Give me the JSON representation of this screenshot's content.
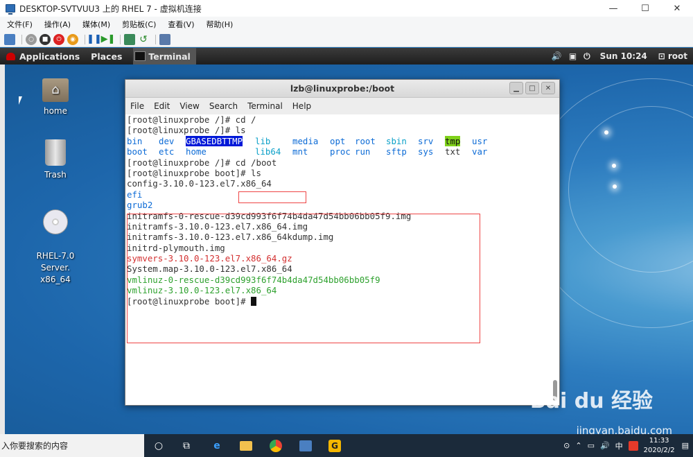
{
  "host": {
    "title": "DESKTOP-SVTVUU3 上的 RHEL 7 - 虚拟机连接",
    "menu": [
      "文件(F)",
      "操作(A)",
      "媒体(M)",
      "剪贴板(C)",
      "查看(V)",
      "帮助(H)"
    ]
  },
  "gnome": {
    "applications": "Applications",
    "places": "Places",
    "terminal_task": "Terminal",
    "clock": "Sun 10:24",
    "user": "root"
  },
  "desktop": {
    "icons": [
      {
        "label": "home"
      },
      {
        "label": "Trash"
      },
      {
        "label": "RHEL-7.0 Server.\nx86_64"
      }
    ]
  },
  "terminal": {
    "title": "lzb@linuxprobe:/boot",
    "menu": [
      "File",
      "Edit",
      "View",
      "Search",
      "Terminal",
      "Help"
    ],
    "lines": [
      "[root@linuxprobe /]# cd /",
      "[root@linuxprobe /]# ls"
    ],
    "ls_row1": [
      "bin",
      "dev",
      "GBASEDBTTMP",
      "lib",
      "media",
      "opt",
      "root",
      "sbin",
      "srv",
      "tmp",
      "usr"
    ],
    "ls_row2": [
      "boot",
      "etc",
      "home",
      "lib64",
      "mnt",
      "proc",
      "run",
      "sftp",
      "sys",
      "txt",
      "var"
    ],
    "cd_prompt": "[root@linuxprobe /]# ",
    "cd_cmd": "cd /boot",
    "ls_boot_cmd": "[root@linuxprobe boot]# ls",
    "boot_files": [
      {
        "name": "config-3.10.0-123.el7.x86_64",
        "color": "default"
      },
      {
        "name": "efi",
        "color": "blue"
      },
      {
        "name": "grub2",
        "color": "blue"
      },
      {
        "name": "initramfs-0-rescue-d39cd993f6f74b4da47d54bb06bb05f9.img",
        "color": "default"
      },
      {
        "name": "initramfs-3.10.0-123.el7.x86_64.img",
        "color": "default"
      },
      {
        "name": "initramfs-3.10.0-123.el7.x86_64kdump.img",
        "color": "default"
      },
      {
        "name": "initrd-plymouth.img",
        "color": "default"
      },
      {
        "name": "symvers-3.10.0-123.el7.x86_64.gz",
        "color": "red"
      },
      {
        "name": "System.map-3.10.0-123.el7.x86_64",
        "color": "default"
      },
      {
        "name": "vmlinuz-0-rescue-d39cd993f6f74b4da47d54bb06bb05f9",
        "color": "green"
      },
      {
        "name": "vmlinuz-3.10.0-123.el7.x86_64",
        "color": "green"
      }
    ],
    "final_prompt": "[root@linuxprobe boot]# "
  },
  "taskbar": {
    "search_placeholder": "在这里输入你要搜索的内容",
    "search_visible": "入你要搜索的内容",
    "time": "11:33",
    "date": "2020/2/2",
    "ime": "中"
  },
  "watermark": {
    "brand": "Bai du 经验",
    "url": "jingyan.baidu.com"
  }
}
